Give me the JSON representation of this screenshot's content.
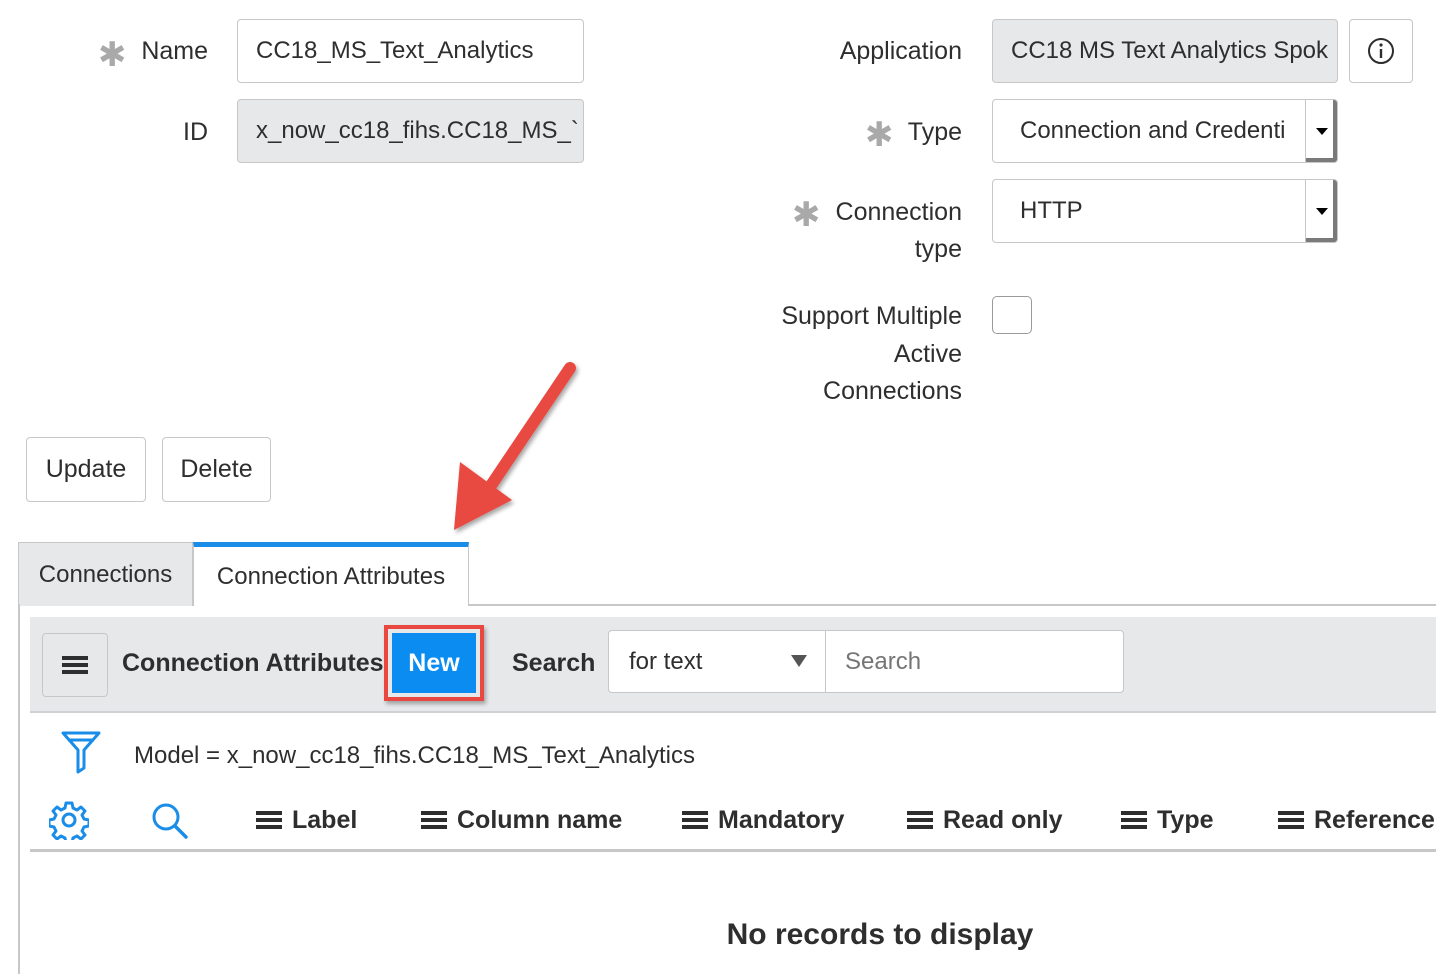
{
  "form": {
    "name_label": "Name",
    "name_value": "CC18_MS_Text_Analytics",
    "id_label": "ID",
    "id_value": "x_now_cc18_fihs.CC18_MS_`",
    "application_label": "Application",
    "application_value": "CC18 MS Text Analytics Spok",
    "type_label": "Type",
    "type_value": "Connection and Credenti",
    "connection_type_label_line1": "Connection",
    "connection_type_label_line2": "type",
    "connection_type_value": "HTTP",
    "support_multiple_line1": "Support Multiple",
    "support_multiple_line2": "Active",
    "support_multiple_line3": "Connections",
    "support_multiple_checked": false
  },
  "actions": {
    "update_label": "Update",
    "delete_label": "Delete"
  },
  "tabs": [
    {
      "label": "Connections",
      "active": false
    },
    {
      "label": "Connection Attributes",
      "active": true
    }
  ],
  "list": {
    "title": "Connection Attributes",
    "new_label": "New",
    "search_label": "Search",
    "search_field_value": "for text",
    "search_placeholder": "Search",
    "filter_text": "Model = x_now_cc18_fihs.CC18_MS_Text_Analytics",
    "columns": [
      "Label",
      "Column name",
      "Mandatory",
      "Read only",
      "Type",
      "Reference"
    ],
    "empty_message": "No records to display"
  },
  "colors": {
    "accent_blue": "#0a8cf0",
    "highlight_red": "#e8483f",
    "tab_active_bar": "#1a8de8",
    "icon_blue": "#1a8de8"
  }
}
